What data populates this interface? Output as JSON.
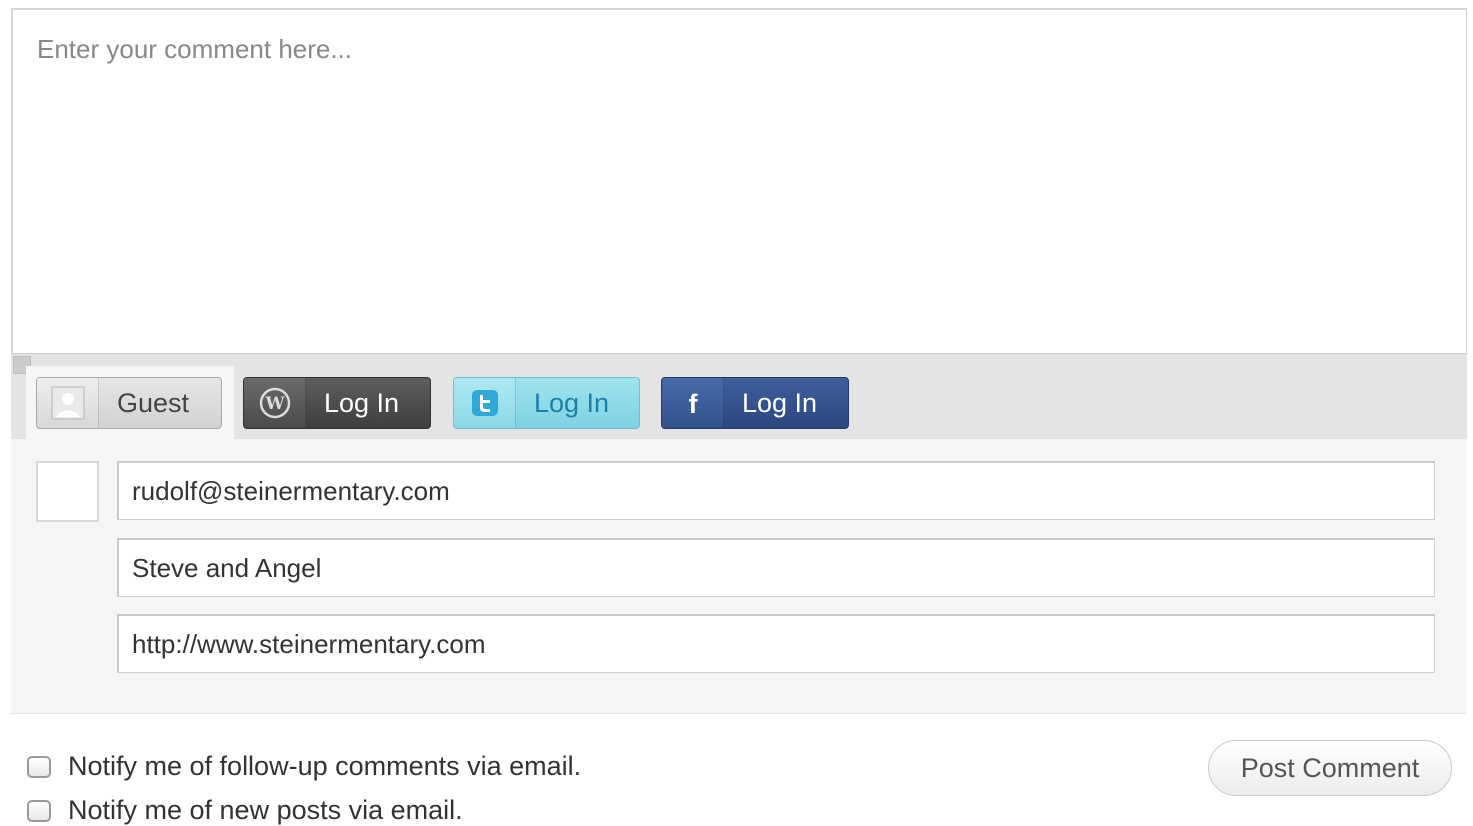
{
  "comment": {
    "placeholder": "Enter your comment here..."
  },
  "tabs": [
    {
      "id": "guest",
      "label": "Guest",
      "icon": "person-icon",
      "active": true
    },
    {
      "id": "wordpress",
      "label": "Log In",
      "icon": "wordpress-icon"
    },
    {
      "id": "twitter",
      "label": "Log In",
      "icon": "twitter-icon"
    },
    {
      "id": "facebook",
      "label": "Log In",
      "icon": "facebook-icon"
    }
  ],
  "guest_form": {
    "email": "rudolf@steinermentary.com",
    "name": "Steve and Angel",
    "website": "http://www.steinermentary.com"
  },
  "options": {
    "notify_followup": "Notify me of follow-up comments via email.",
    "notify_posts": "Notify me of new posts via email."
  },
  "submit": {
    "label": "Post Comment"
  },
  "colors": {
    "wordpress": "#4a4a4a",
    "twitter": "#8ad8e6",
    "facebook": "#34528c",
    "tab_bar": "#e4e4e4"
  }
}
